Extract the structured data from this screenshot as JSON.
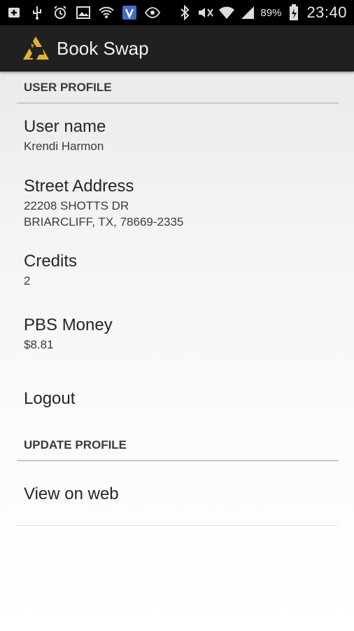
{
  "status_bar": {
    "battery": "89%",
    "time": "23:40"
  },
  "action_bar": {
    "title": "Book Swap"
  },
  "sections": {
    "user_profile": "USER PROFILE",
    "update_profile": "UPDATE PROFILE"
  },
  "profile": {
    "user_name": {
      "label": "User name",
      "value": "Krendi Harmon"
    },
    "street_address": {
      "label": "Street Address",
      "line1": "22208 SHOTTS DR",
      "line2": "BRIARCLIFF, TX, 78669-2335"
    },
    "credits": {
      "label": "Credits",
      "value": "2"
    },
    "pbs_money": {
      "label": "PBS Money",
      "value": "$8.81"
    },
    "logout": {
      "label": "Logout"
    }
  },
  "update": {
    "view_on_web": {
      "label": "View on web"
    }
  },
  "colors": {
    "status_bar_bg": "#000000",
    "action_bar_bg": "#202020",
    "logo_gold": "#e0b42c"
  }
}
